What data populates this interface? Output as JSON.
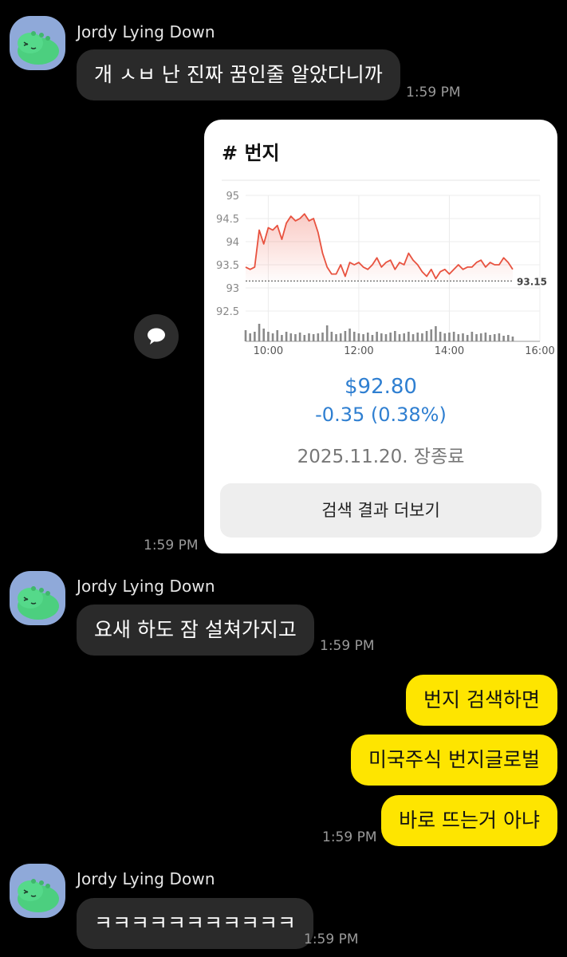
{
  "colors": {
    "background": "#000000",
    "incoming_bubble": "#2a2a2a",
    "outgoing_bubble": "#fee500",
    "price_blue": "#2f7fd1",
    "line_red": "#e8523f"
  },
  "messages": [
    {
      "sender": "Jordy Lying Down",
      "avatar_icon": "jordy-dinosaur-avatar-icon",
      "text": "개 ㅅㅂ 난 진짜 꿈인줄 알았다니까",
      "time": "1:59 PM"
    },
    {
      "card_time": "1:59 PM"
    },
    {
      "sender": "Jordy Lying Down",
      "avatar_icon": "jordy-dinosaur-avatar-icon",
      "text": "요새 하도 잠 설쳐가지고",
      "time": "1:59 PM"
    },
    {
      "outgoing": [
        "번지 검색하면",
        "미국주식 번지글로벌",
        "바로 뜨는거 아냐"
      ],
      "time": "1:59 PM"
    },
    {
      "sender": "Jordy Lying Down",
      "avatar_icon": "jordy-dinosaur-avatar-icon",
      "text": "ㅋㅋㅋㅋㅋㅋㅋㅋㅋㅋㅋ",
      "time": "1:59 PM"
    }
  ],
  "stock_card": {
    "title": "# 번지",
    "price": "$92.80",
    "change": "-0.35 (0.38%)",
    "date": "2025.11.20. 장종료",
    "more_button": "검색 결과 더보기",
    "share_icon": "chat-share-icon"
  },
  "chart_data": {
    "type": "line",
    "y_ticks": [
      "95",
      "94.5",
      "94",
      "93.5",
      "93",
      "92.5"
    ],
    "x_ticks": [
      "10:00",
      "12:00",
      "14:00",
      "16:00"
    ],
    "ylim": [
      92.5,
      95
    ],
    "xlim": [
      "9:30",
      "16:00"
    ],
    "reference_line": {
      "value": 93.15,
      "label": "93.15"
    },
    "grid": true,
    "series": [
      {
        "x": [
          "9:30",
          "9:36",
          "9:42",
          "9:48",
          "9:54",
          "10:00",
          "10:06",
          "10:12",
          "10:18",
          "10:24",
          "10:30",
          "10:36",
          "10:42",
          "10:48",
          "10:54",
          "11:00",
          "11:06",
          "11:12",
          "11:18",
          "11:24",
          "11:30",
          "11:36",
          "11:42",
          "11:48",
          "11:54",
          "12:00",
          "12:06",
          "12:12",
          "12:18",
          "12:24",
          "12:30",
          "12:36",
          "12:42",
          "12:48",
          "12:54",
          "13:00",
          "13:06",
          "13:12",
          "13:18",
          "13:24",
          "13:30",
          "13:36",
          "13:42",
          "13:48",
          "13:54",
          "14:00",
          "14:06",
          "14:12",
          "14:18",
          "14:24",
          "14:30",
          "14:36",
          "14:42",
          "14:48",
          "14:54",
          "15:00",
          "15:06",
          "15:12",
          "15:18",
          "15:24"
        ],
        "values": [
          93.45,
          93.4,
          93.45,
          94.25,
          93.95,
          94.3,
          94.25,
          94.35,
          94.05,
          94.4,
          94.55,
          94.45,
          94.5,
          94.6,
          94.45,
          94.5,
          94.2,
          93.75,
          93.45,
          93.3,
          93.3,
          93.5,
          93.25,
          93.55,
          93.5,
          93.55,
          93.45,
          93.4,
          93.5,
          93.65,
          93.45,
          93.55,
          93.6,
          93.4,
          93.55,
          93.5,
          93.75,
          93.6,
          93.5,
          93.35,
          93.25,
          93.4,
          93.2,
          93.35,
          93.4,
          93.3,
          93.4,
          93.5,
          93.4,
          93.45,
          93.45,
          93.55,
          93.6,
          93.45,
          93.55,
          93.5,
          93.5,
          93.65,
          93.55,
          93.4
        ]
      }
    ],
    "volume": [
      14,
      10,
      12,
      22,
      16,
      12,
      10,
      14,
      8,
      12,
      10,
      9,
      11,
      8,
      10,
      9,
      10,
      11,
      20,
      12,
      9,
      10,
      13,
      16,
      12,
      10,
      9,
      11,
      8,
      12,
      10,
      9,
      11,
      13,
      9,
      10,
      12,
      9,
      11,
      10,
      13,
      15,
      19,
      12,
      10,
      11,
      12,
      9,
      10,
      8,
      12,
      9,
      10,
      11,
      8,
      9,
      10,
      7,
      8,
      6
    ]
  }
}
